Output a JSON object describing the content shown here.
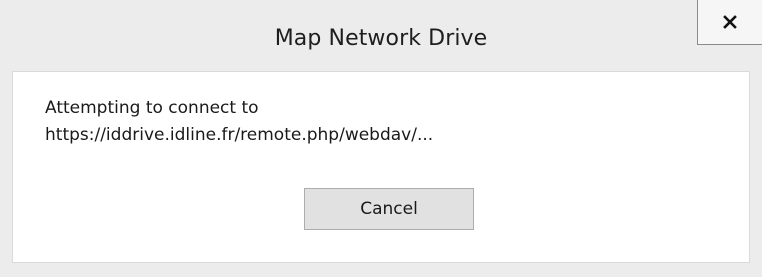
{
  "window": {
    "title": "Map Network Drive",
    "close_icon": "close-icon"
  },
  "dialog": {
    "message_line1": "Attempting to connect to",
    "message_line2": "https://iddrive.idline.fr/remote.php/webdav/...",
    "cancel_label": "Cancel"
  },
  "colors": {
    "window_bg": "#ececec",
    "content_bg": "#ffffff",
    "button_bg": "#e1e1e1",
    "button_border": "#adadad"
  }
}
